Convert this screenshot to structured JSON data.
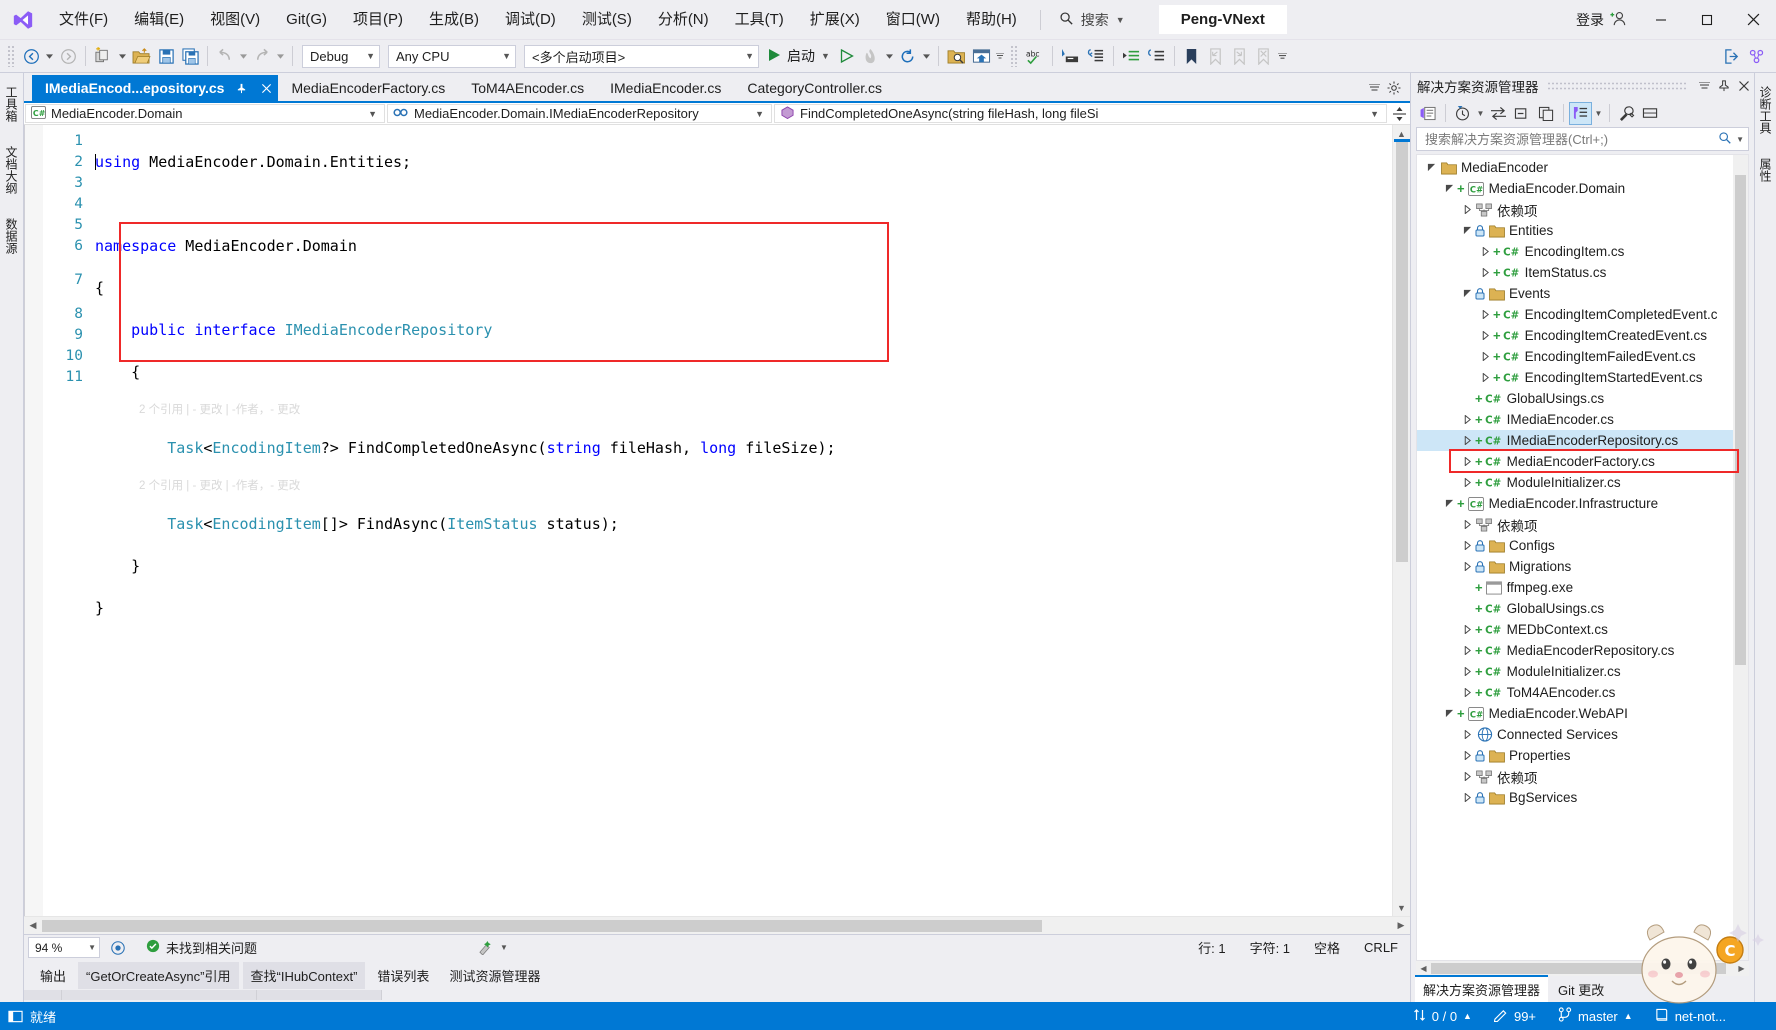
{
  "titlebar": {
    "menu": [
      {
        "label": "文件(F)",
        "key": "F"
      },
      {
        "label": "编辑(E)",
        "key": "E"
      },
      {
        "label": "视图(V)",
        "key": "V"
      },
      {
        "label": "Git(G)",
        "key": "G"
      },
      {
        "label": "项目(P)",
        "key": "P"
      },
      {
        "label": "生成(B)",
        "key": "B"
      },
      {
        "label": "调试(D)",
        "key": "D"
      },
      {
        "label": "测试(S)",
        "key": "S"
      },
      {
        "label": "分析(N)",
        "key": "N"
      },
      {
        "label": "工具(T)",
        "key": "T"
      },
      {
        "label": "扩展(X)",
        "key": "X"
      },
      {
        "label": "窗口(W)",
        "key": "W"
      },
      {
        "label": "帮助(H)",
        "key": "H"
      }
    ],
    "search_label": "搜索",
    "window_title": "Peng-VNext",
    "signin_label": "登录",
    "minimize": "─",
    "maximize": "□",
    "close": "✕"
  },
  "toolbar": {
    "configuration": "Debug",
    "platform": "Any CPU",
    "startup_project": "<多个启动项目>",
    "run_label": "启动"
  },
  "rails": {
    "left": [
      "工具箱",
      "文档大纲",
      "数据源"
    ],
    "right": [
      "诊断工具",
      "属性"
    ]
  },
  "editor": {
    "tabs": [
      {
        "label": "IMediaEncod...epository.cs",
        "active": true
      },
      {
        "label": "MediaEncoderFactory.cs",
        "active": false
      },
      {
        "label": "ToM4AEncoder.cs",
        "active": false
      },
      {
        "label": "IMediaEncoder.cs",
        "active": false
      },
      {
        "label": "CategoryController.cs",
        "active": false
      }
    ],
    "nav": {
      "project": "MediaEncoder.Domain",
      "type": "MediaEncoder.Domain.IMediaEncoderRepository",
      "member": "FindCompletedOneAsync(string fileHash, long fileSi"
    },
    "line_numbers": [
      "1",
      "2",
      "3",
      "4",
      "5",
      "6",
      "7",
      "8",
      "9",
      "10",
      "11"
    ],
    "code_lines": [
      "using MediaEncoder.Domain.Entities;",
      "",
      "namespace MediaEncoder.Domain",
      "{",
      "    public interface IMediaEncoderRepository",
      "    {",
      "        Task<EncodingItem?> FindCompletedOneAsync(string fileHash, long fileSize);",
      "        Task<EncodingItem[]> FindAsync(ItemStatus status);",
      "    }",
      "}",
      ""
    ],
    "codelens": "2 个引用 | - 更改 | -作者，- 更改",
    "highlight_color": "#ef2929"
  },
  "editor_status": {
    "zoom": "94 %",
    "issues": "未找到相关问题",
    "line_label": "行: 1",
    "col_label": "字符: 1",
    "spaces": "空格",
    "eol": "CRLF"
  },
  "output_tabs": [
    {
      "label": "输出",
      "selected": false
    },
    {
      "label": "“GetOrCreateAsync”引用",
      "selected": true
    },
    {
      "label": "查找“IHubContext”",
      "selected": true
    },
    {
      "label": "错误列表",
      "selected": false
    },
    {
      "label": "测试资源管理器",
      "selected": false
    }
  ],
  "solution_explorer": {
    "title": "解决方案资源管理器",
    "search_placeholder": "搜索解决方案资源管理器(Ctrl+;)",
    "tree": [
      {
        "label": "MediaEncoder",
        "depth": 0,
        "arrow": "open",
        "icon": "folder",
        "plus": false,
        "selected": false
      },
      {
        "label": "MediaEncoder.Domain",
        "depth": 1,
        "arrow": "open",
        "icon": "csproj",
        "plus": true,
        "selected": false
      },
      {
        "label": "依赖项",
        "depth": 2,
        "arrow": "closed",
        "icon": "deps",
        "plus": false,
        "selected": false
      },
      {
        "label": "Entities",
        "depth": 2,
        "arrow": "open",
        "icon": "folderlock",
        "plus": false,
        "selected": false
      },
      {
        "label": "EncodingItem.cs",
        "depth": 3,
        "arrow": "closed",
        "icon": "cs",
        "plus": true,
        "selected": false
      },
      {
        "label": "ItemStatus.cs",
        "depth": 3,
        "arrow": "closed",
        "icon": "cs",
        "plus": true,
        "selected": false
      },
      {
        "label": "Events",
        "depth": 2,
        "arrow": "open",
        "icon": "folderlock",
        "plus": false,
        "selected": false
      },
      {
        "label": "EncodingItemCompletedEvent.c",
        "depth": 3,
        "arrow": "closed",
        "icon": "cs",
        "plus": true,
        "selected": false
      },
      {
        "label": "EncodingItemCreatedEvent.cs",
        "depth": 3,
        "arrow": "closed",
        "icon": "cs",
        "plus": true,
        "selected": false
      },
      {
        "label": "EncodingItemFailedEvent.cs",
        "depth": 3,
        "arrow": "closed",
        "icon": "cs",
        "plus": true,
        "selected": false
      },
      {
        "label": "EncodingItemStartedEvent.cs",
        "depth": 3,
        "arrow": "closed",
        "icon": "cs",
        "plus": true,
        "selected": false
      },
      {
        "label": "GlobalUsings.cs",
        "depth": 2,
        "arrow": "none",
        "icon": "cs",
        "plus": true,
        "selected": false
      },
      {
        "label": "IMediaEncoder.cs",
        "depth": 2,
        "arrow": "closed",
        "icon": "cs",
        "plus": true,
        "selected": false
      },
      {
        "label": "IMediaEncoderRepository.cs",
        "depth": 2,
        "arrow": "closed",
        "icon": "cs",
        "plus": true,
        "selected": true
      },
      {
        "label": "MediaEncoderFactory.cs",
        "depth": 2,
        "arrow": "closed",
        "icon": "cs",
        "plus": true,
        "selected": false
      },
      {
        "label": "ModuleInitializer.cs",
        "depth": 2,
        "arrow": "closed",
        "icon": "cs",
        "plus": true,
        "selected": false
      },
      {
        "label": "MediaEncoder.Infrastructure",
        "depth": 1,
        "arrow": "open",
        "icon": "csproj",
        "plus": true,
        "selected": false
      },
      {
        "label": "依赖项",
        "depth": 2,
        "arrow": "closed",
        "icon": "deps",
        "plus": false,
        "selected": false
      },
      {
        "label": "Configs",
        "depth": 2,
        "arrow": "closed",
        "icon": "folderlock",
        "plus": false,
        "selected": false
      },
      {
        "label": "Migrations",
        "depth": 2,
        "arrow": "closed",
        "icon": "folderlock",
        "plus": false,
        "selected": false
      },
      {
        "label": "ffmpeg.exe",
        "depth": 2,
        "arrow": "none",
        "icon": "exe",
        "plus": true,
        "selected": false
      },
      {
        "label": "GlobalUsings.cs",
        "depth": 2,
        "arrow": "none",
        "icon": "cs",
        "plus": true,
        "selected": false
      },
      {
        "label": "MEDbContext.cs",
        "depth": 2,
        "arrow": "closed",
        "icon": "cs",
        "plus": true,
        "selected": false
      },
      {
        "label": "MediaEncoderRepository.cs",
        "depth": 2,
        "arrow": "closed",
        "icon": "cs",
        "plus": true,
        "selected": false
      },
      {
        "label": "ModuleInitializer.cs",
        "depth": 2,
        "arrow": "closed",
        "icon": "cs",
        "plus": true,
        "selected": false
      },
      {
        "label": "ToM4AEncoder.cs",
        "depth": 2,
        "arrow": "closed",
        "icon": "cs",
        "plus": true,
        "selected": false
      },
      {
        "label": "MediaEncoder.WebAPI",
        "depth": 1,
        "arrow": "open",
        "icon": "csproj",
        "plus": true,
        "selected": false
      },
      {
        "label": "Connected Services",
        "depth": 2,
        "arrow": "closed",
        "icon": "services",
        "plus": false,
        "selected": false
      },
      {
        "label": "Properties",
        "depth": 2,
        "arrow": "closed",
        "icon": "folderlock",
        "plus": false,
        "selected": false
      },
      {
        "label": "依赖项",
        "depth": 2,
        "arrow": "closed",
        "icon": "deps",
        "plus": false,
        "selected": false
      },
      {
        "label": "BgServices",
        "depth": 2,
        "arrow": "closed",
        "icon": "folderlock",
        "plus": false,
        "selected": false
      }
    ],
    "footer_tabs": [
      {
        "label": "解决方案资源管理器",
        "selected": true
      },
      {
        "label": "Git 更改",
        "selected": false
      }
    ]
  },
  "statusbar": {
    "ready": "就绪",
    "updown": "0 / 0",
    "errors": "99+",
    "branch": "master",
    "repo": "net-not...",
    "accent": "#0078d4"
  }
}
